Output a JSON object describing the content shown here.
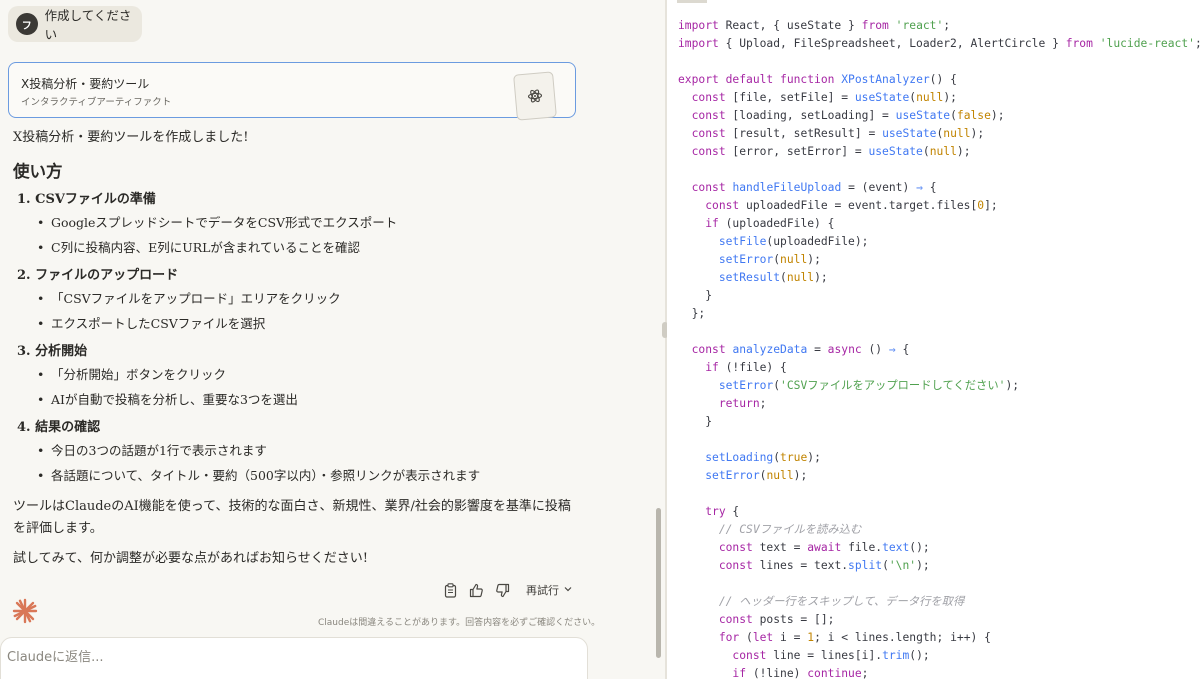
{
  "user_message": {
    "avatar_letter": "フ",
    "text": "作成してください"
  },
  "artifact": {
    "title": "X投稿分析・要約ツール",
    "subtitle": "インタラクティブアーティファクト"
  },
  "response": {
    "intro": "X投稿分析・要約ツールを作成しました!",
    "heading": "使い方",
    "steps": [
      {
        "title": "1. CSVファイルの準備",
        "items": [
          "GoogleスプレッドシートでデータをCSV形式でエクスポート",
          "C列に投稿内容、E列にURLが含まれていることを確認"
        ]
      },
      {
        "title": "2. ファイルのアップロード",
        "items": [
          "「CSVファイルをアップロード」エリアをクリック",
          "エクスポートしたCSVファイルを選択"
        ]
      },
      {
        "title": "3. 分析開始",
        "items": [
          "「分析開始」ボタンをクリック",
          "AIが自動で投稿を分析し、重要な3つを選出"
        ]
      },
      {
        "title": "4. 結果の確認",
        "items": [
          "今日の3つの話題が1行で表示されます",
          "各話題について、タイトル・要約（500字以内）・参照リンクが表示されます"
        ]
      }
    ],
    "para1": "ツールはClaudeのAI機能を使って、技術的な面白さ、新規性、業界/社会的影響度を基準に投稿を評価します。",
    "para2": "試してみて、何か調整が必要な点があればお知らせください!"
  },
  "actions": {
    "retry_label": "再試行"
  },
  "disclaimer": "Claudeは間違えることがあります。回答内容を必ずご確認ください。",
  "input": {
    "placeholder": "Claudeに返信..."
  },
  "colors": {
    "accent_blue": "#6b9be0",
    "claude_orange": "#d97757"
  },
  "icons": [
    "copy-icon",
    "thumbs-up-icon",
    "thumbs-down-icon",
    "chevron-down-icon",
    "claude-logo-icon",
    "artifact-thumbnail-icon"
  ]
}
